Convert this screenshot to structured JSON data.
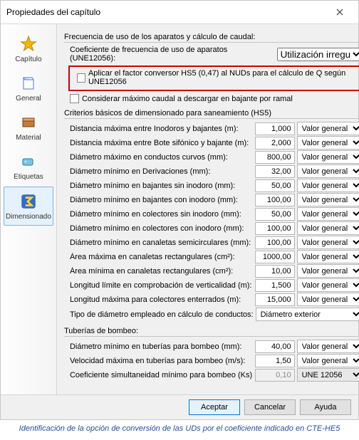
{
  "window": {
    "title": "Propiedades del capítulo"
  },
  "sidebar": {
    "items": [
      {
        "label": "Capítulo",
        "name": "sidebar-item-capitulo"
      },
      {
        "label": "General",
        "name": "sidebar-item-general"
      },
      {
        "label": "Material",
        "name": "sidebar-item-material"
      },
      {
        "label": "Etiquetas",
        "name": "sidebar-item-etiquetas"
      },
      {
        "label": "Dimensionado",
        "name": "sidebar-item-dimensionado"
      }
    ]
  },
  "frequency": {
    "section": "Frecuencia de uso de los aparatos y cálculo de caudal:",
    "coef_label": "Coeficiente de frecuencia de uso de aparatos (UNE12056):",
    "coef_value": "Utilización irregular",
    "apply_hs5": "Aplicar el factor conversor HS5 (0,47) al NUDs para el cálculo de Q según UNE12056",
    "consider_max": "Considerar máximo caudal a descargar en bajante por ramal"
  },
  "criteria": {
    "section": "Criterios básicos de dimensionado para saneamiento (HS5)",
    "rows": [
      {
        "label": "Distancia máxima entre Inodoros y bajantes (m):",
        "value": "1,000",
        "src": "Valor general"
      },
      {
        "label": "Distancia máxima entre Bote sifónico y bajante (m):",
        "value": "2,000",
        "src": "Valor general"
      },
      {
        "label": "Diámetro máximo en conductos curvos (mm):",
        "value": "800,00",
        "src": "Valor general"
      },
      {
        "label": "Diámetro mínimo en Derivaciones (mm):",
        "value": "32,00",
        "src": "Valor general"
      },
      {
        "label": "Diámetro mínimo en bajantes sin inodoro (mm):",
        "value": "50,00",
        "src": "Valor general"
      },
      {
        "label": "Diámetro mínimo en bajantes con inodoro (mm):",
        "value": "100,00",
        "src": "Valor general"
      },
      {
        "label": "Diámetro mínimo en colectores sin inodoro (mm):",
        "value": "50,00",
        "src": "Valor general"
      },
      {
        "label": "Diámetro mínimo en colectores con inodoro (mm):",
        "value": "100,00",
        "src": "Valor general"
      },
      {
        "label": "Diámetro mínimo en canaletas semicirculares (mm):",
        "value": "100,00",
        "src": "Valor general"
      },
      {
        "label": "Área máxima en canaletas rectangulares (cm²):",
        "value": "1000,00",
        "src": "Valor general"
      },
      {
        "label": "Área mínima en canaletas rectangulares (cm²):",
        "value": "10,00",
        "src": "Valor general"
      },
      {
        "label": "Longitud límite en comprobación de verticalidad (m):",
        "value": "1,500",
        "src": "Valor general"
      },
      {
        "label": "Longitud máxima para colectores enterrados (m):",
        "value": "15,000",
        "src": "Valor general"
      }
    ],
    "diameter_type_label": "Tipo de diámetro empleado en cálculo de conductos:",
    "diameter_type_value": "Diámetro exterior"
  },
  "pump": {
    "section": "Tuberías de bombeo:",
    "rows": [
      {
        "label": "Diámetro mínimo en tuberías para bombeo (mm):",
        "value": "40,00",
        "src": "Valor general"
      },
      {
        "label": "Velocidad máxima en tuberías para bombeo (m/s):",
        "value": "1,50",
        "src": "Valor general"
      },
      {
        "label": "Coeficiente simultaneidad mínimo para bombeo (Ks)",
        "value": "0,10",
        "src": "UNE 12056",
        "readonly": true
      }
    ]
  },
  "footer": {
    "ok": "Aceptar",
    "cancel": "Cancelar",
    "help": "Ayuda"
  },
  "caption": "Identificación de la opción de conversión de las UDs por el coeficiente indicado en CTE-HE5"
}
